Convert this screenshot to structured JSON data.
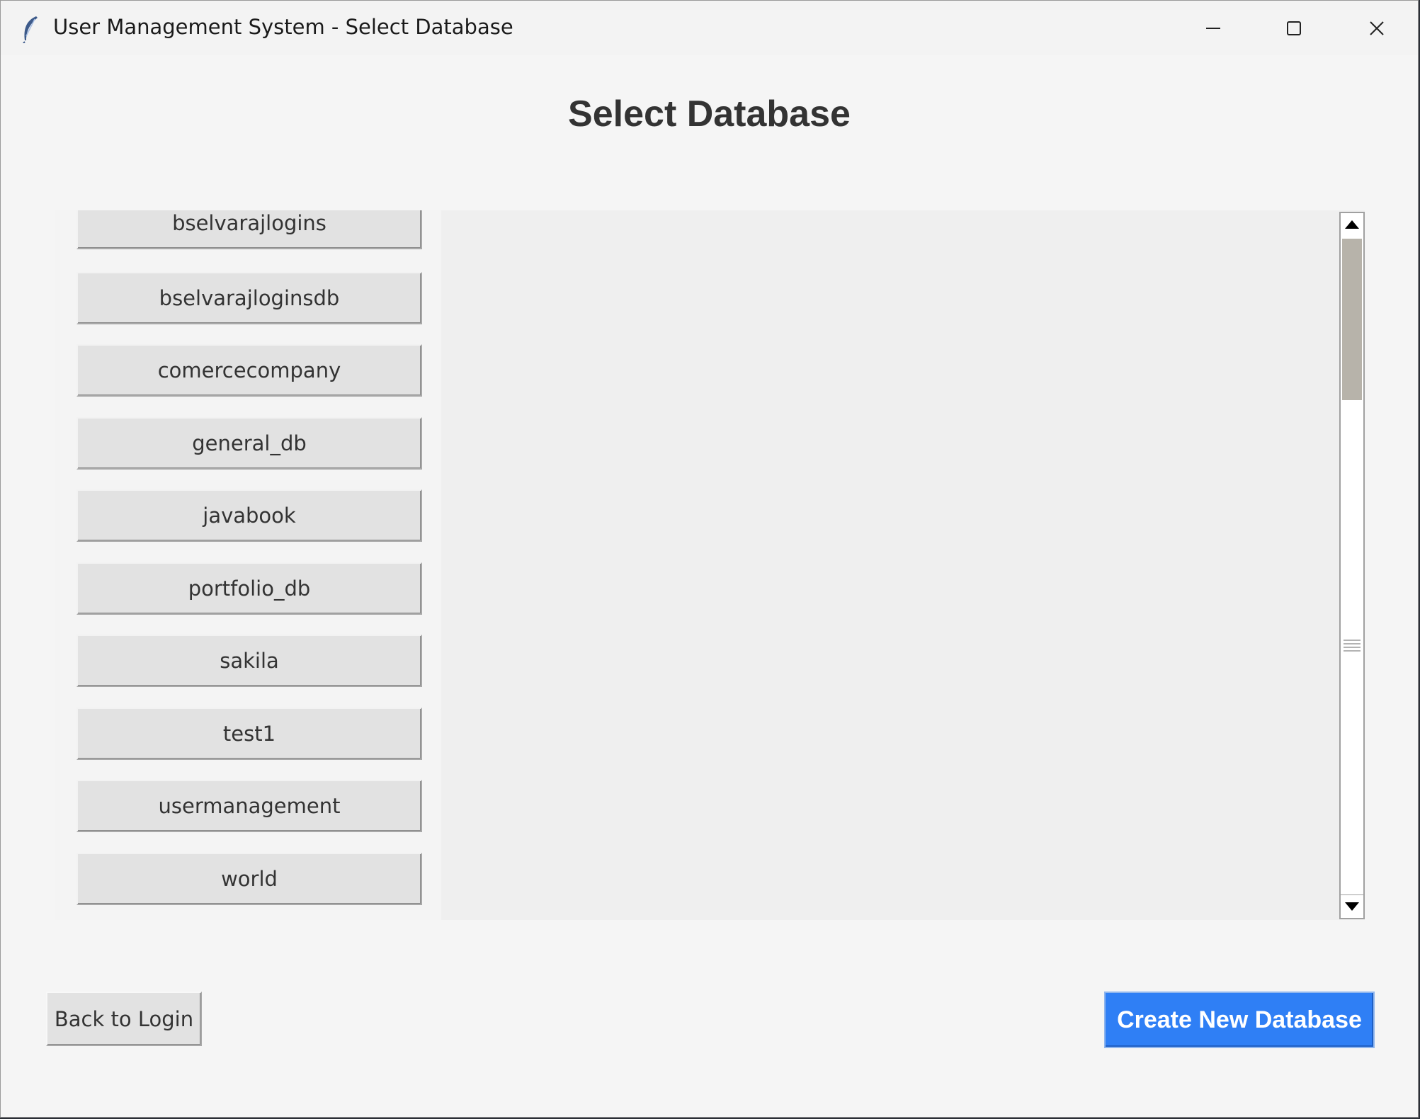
{
  "window": {
    "title": "User Management System - Select Database"
  },
  "heading": "Select Database",
  "databases": [
    "bselvarajlogins",
    "bselvarajloginsdb",
    "comercecompany",
    "general_db",
    "javabook",
    "portfolio_db",
    "sakila",
    "test1",
    "usermanagement",
    "world"
  ],
  "footer": {
    "back_label": "Back to Login",
    "create_label": "Create New Database"
  },
  "colors": {
    "accent": "#2f7ff5",
    "background": "#f5f5f5",
    "button_face": "#e2e2e2",
    "scroll_thumb": "#b7b3aa"
  },
  "icons": {
    "app": "feather-icon",
    "minimize": "minimize-icon",
    "maximize": "maximize-icon",
    "close": "close-icon",
    "scroll_up": "triangle-up-icon",
    "scroll_down": "triangle-down-icon",
    "grip": "grip-lines-icon"
  }
}
